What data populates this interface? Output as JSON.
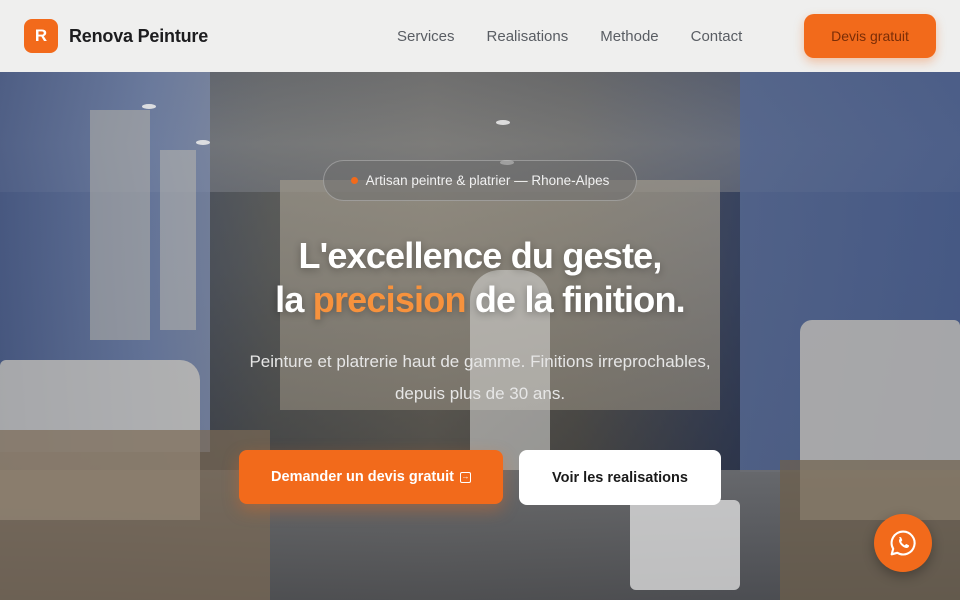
{
  "brand": {
    "logo_letter": "R",
    "name": "Renova Peinture",
    "accent_color": "#f26a1b"
  },
  "nav": {
    "items": [
      {
        "label": "Services"
      },
      {
        "label": "Realisations"
      },
      {
        "label": "Methode"
      },
      {
        "label": "Contact"
      }
    ],
    "cta_label": "Devis gratuit"
  },
  "hero": {
    "badge": "Artisan peintre & platrier — Rhone-Alpes",
    "headline_line1": "L'excellence du geste,",
    "headline_line2_prefix": "la",
    "headline_line2_accent": "precision",
    "headline_line2_suffix": "de la finition.",
    "subtitle_line1": "Peinture et platrerie haut de gamme. Finitions irreprochables,",
    "subtitle_line2": "depuis plus de 30 ans.",
    "primary_cta": "Demander un devis gratuit",
    "secondary_cta": "Voir les realisations"
  },
  "floating": {
    "whatsapp_icon": "whatsapp-icon"
  }
}
